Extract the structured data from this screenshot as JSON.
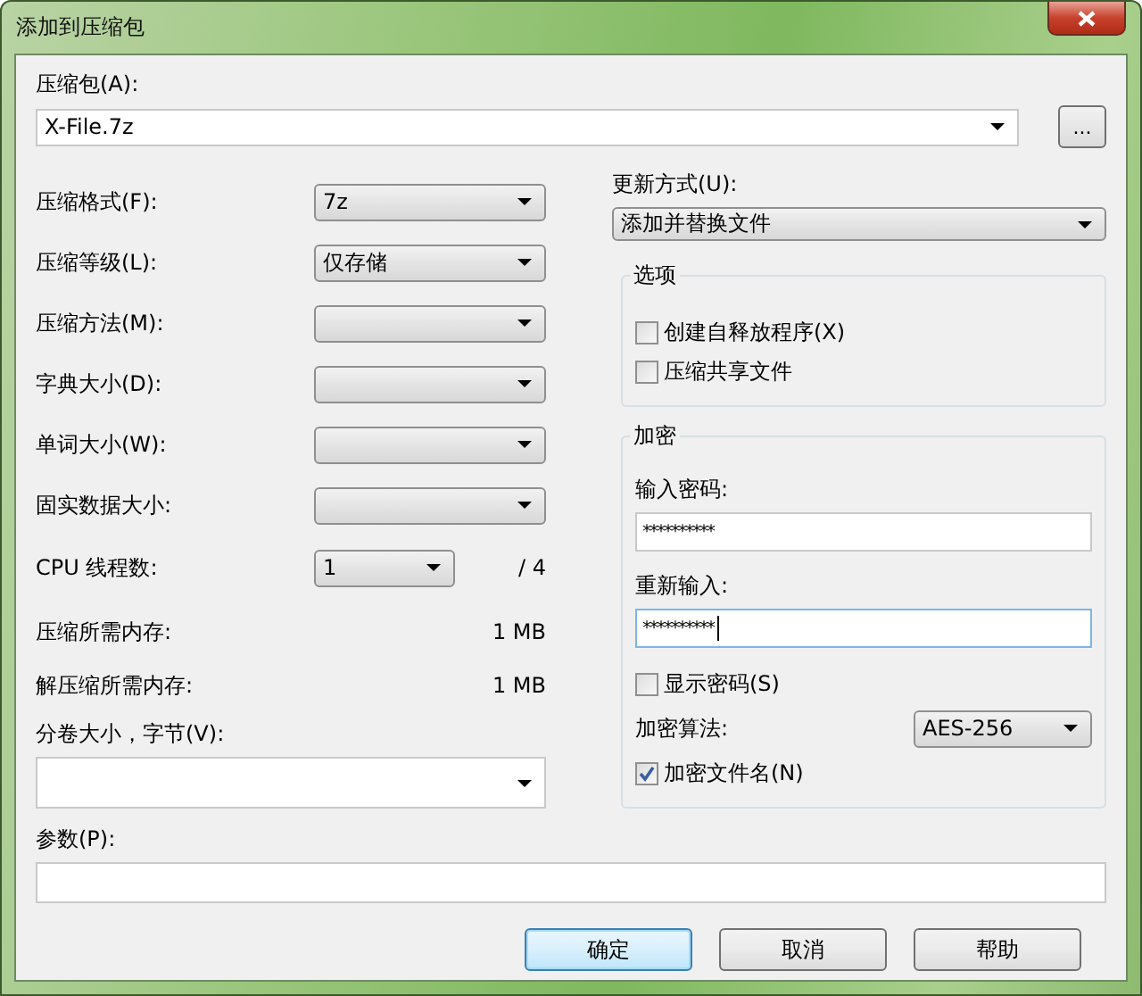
{
  "window": {
    "title": "添加到压缩包"
  },
  "archive": {
    "label": "压缩包(A):",
    "value": "X-File.7z",
    "browse": "..."
  },
  "left_rows": [
    {
      "kind": "combo",
      "label": "压缩格式(F):",
      "value": "7z"
    },
    {
      "kind": "combo",
      "label": "压缩等级(L):",
      "value": "仅存储"
    },
    {
      "kind": "combo",
      "label": "压缩方法(M):"
    },
    {
      "kind": "combo",
      "label": "字典大小(D):"
    },
    {
      "kind": "combo",
      "label": "单词大小(W):"
    },
    {
      "kind": "combo",
      "label": "固实数据大小:"
    },
    {
      "kind": "cpu",
      "label": "CPU 线程数:",
      "value": "1",
      "suffix": "/ 4"
    },
    {
      "kind": "info",
      "label": "压缩所需内存:",
      "value": "1 MB"
    },
    {
      "kind": "info",
      "label": "解压缩所需内存:",
      "value": "1 MB"
    }
  ],
  "split": {
    "label": "分卷大小，字节(V):"
  },
  "update": {
    "label": "更新方式(U):",
    "value": "添加并替换文件"
  },
  "options": {
    "title": "选项",
    "items": [
      {
        "label": "创建自释放程序(X)",
        "checked": false
      },
      {
        "label": "压缩共享文件",
        "checked": false
      }
    ]
  },
  "encryption": {
    "title": "加密",
    "fields": [
      {
        "label": "输入密码:",
        "value": "**********",
        "focused": false
      },
      {
        "label": "重新输入:",
        "value": "**********",
        "focused": true
      }
    ],
    "show_password": {
      "label": "显示密码(S)",
      "checked": false
    },
    "method": {
      "label": "加密算法:",
      "value": "AES-256"
    },
    "encrypt_names": {
      "label": "加密文件名(N)",
      "checked": true
    }
  },
  "params": {
    "label": "参数(P):"
  },
  "buttons": [
    {
      "label": "确定",
      "default": true
    },
    {
      "label": "取消",
      "default": false
    },
    {
      "label": "帮助",
      "default": false
    }
  ]
}
